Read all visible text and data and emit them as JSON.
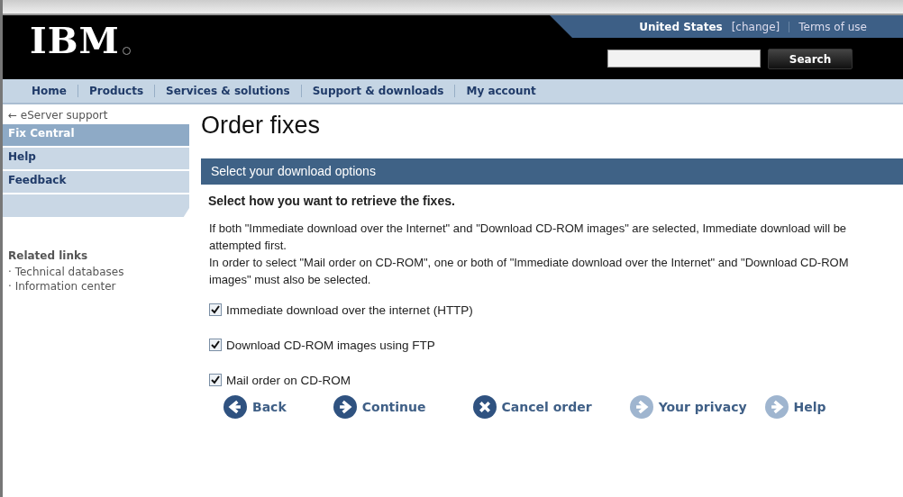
{
  "masthead": {
    "logo": "IBM",
    "country": "United States",
    "change_link": "[change]",
    "terms_link": "Terms of use",
    "search_button": "Search"
  },
  "nav": [
    "Home",
    "Products",
    "Services & solutions",
    "Support & downloads",
    "My account"
  ],
  "sidebar": {
    "back_link": "← eServer support",
    "items": [
      {
        "label": "Fix Central",
        "selected": true
      },
      {
        "label": "Help",
        "selected": false
      },
      {
        "label": "Feedback",
        "selected": false
      }
    ],
    "related_title": "Related links",
    "related": [
      "· Technical databases",
      "· Information center"
    ]
  },
  "page_title": "Order fixes",
  "section_bar": "Select your download options",
  "question": "Select how you want to retrieve the fixes.",
  "paragraphs": [
    "If both \"Immediate download over the Internet\" and \"Download CD-ROM images\" are selected, Immediate download will be attempted first.",
    " In order to select \"Mail order on CD-ROM\", one or both of \"Immediate download over the Internet\" and \"Download CD-ROM images\" must also be selected."
  ],
  "options": [
    {
      "label": "Immediate download over the internet (HTTP)",
      "checked": true
    },
    {
      "label": "Download CD-ROM images using FTP",
      "checked": true
    },
    {
      "label": "Mail order on CD-ROM",
      "checked": true
    }
  ],
  "actions": [
    {
      "label": "Back",
      "kind": "back",
      "primary": true
    },
    {
      "label": "Continue",
      "kind": "forward",
      "primary": true
    },
    {
      "label": "Cancel order",
      "kind": "cancel",
      "primary": true
    },
    {
      "label": "Your privacy",
      "kind": "forward",
      "primary": false
    },
    {
      "label": "Help",
      "kind": "forward",
      "primary": false
    }
  ]
}
